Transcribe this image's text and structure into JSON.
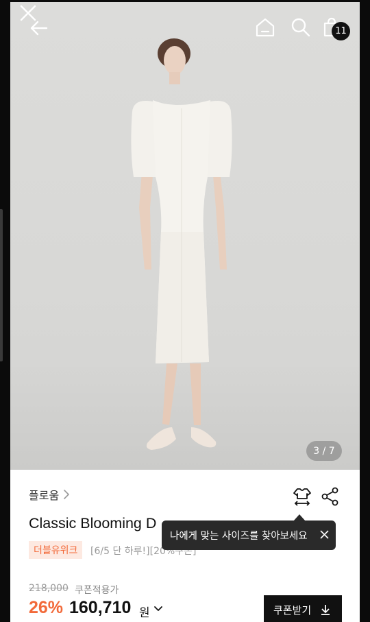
{
  "header": {
    "cart_count": "11",
    "icons": [
      "close-icon",
      "back-arrow-icon",
      "home-icon",
      "search-icon",
      "shopping-bag-icon"
    ]
  },
  "gallery": {
    "current": "3",
    "total": "7",
    "pager_text": "3 / 7"
  },
  "product": {
    "brand": "플로움",
    "title": "Classic Blooming Dress Long (Cr...",
    "title_visible": "Classic Blooming D",
    "promo_badge": "더블유위크",
    "promo_text": "[6/5 단 하루!][20%쿠폰]",
    "original_price": "218,000",
    "coupon_note": "쿠폰적용가",
    "discount_rate": "26%",
    "price": "160,710",
    "currency": "원"
  },
  "tooltip": {
    "text": "나에게 맞는 사이즈를 찾아보세요"
  },
  "actions": {
    "coupon_button": "쿠폰받기"
  },
  "colors": {
    "accent": "#f26a3a",
    "dark": "#111111",
    "tooltip_bg": "#2a2a2a"
  }
}
